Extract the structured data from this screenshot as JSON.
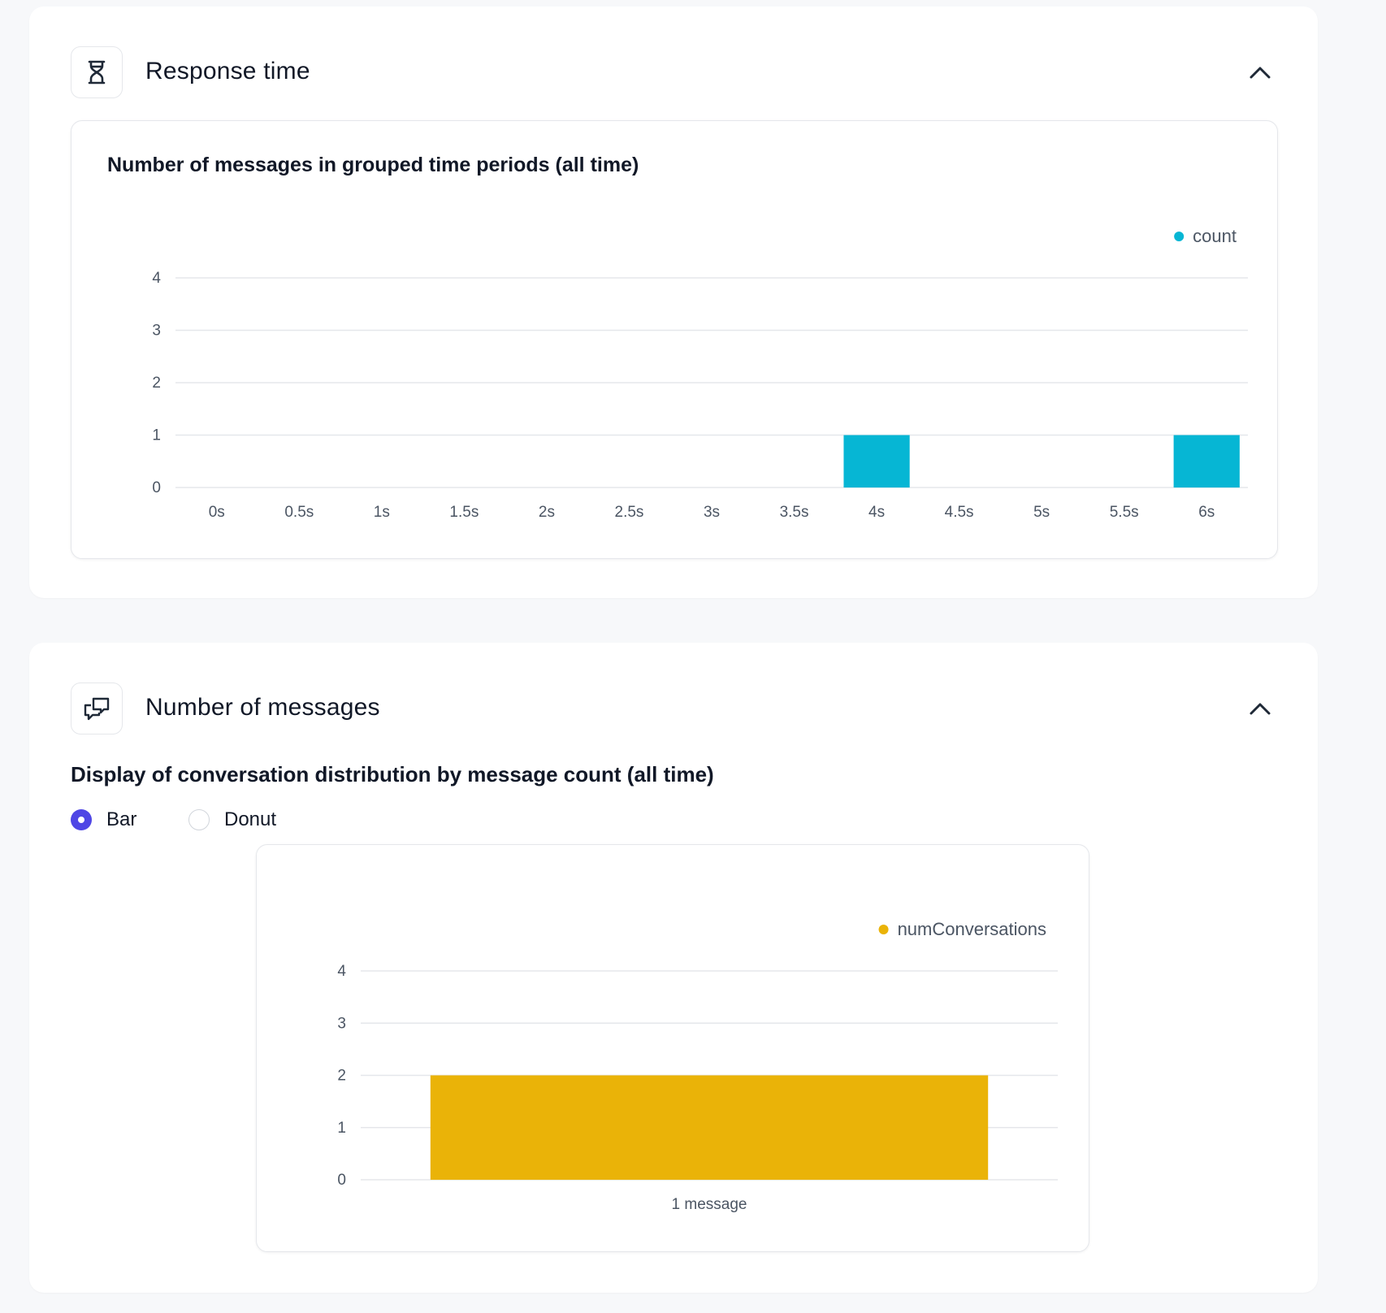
{
  "response_panel": {
    "title": "Response time",
    "icon": "hourglass-icon",
    "collapse_icon": "chevron-up-icon",
    "chart_title": "Number of messages in grouped time periods (all time)"
  },
  "messages_panel": {
    "title": "Number of messages",
    "icon": "chat-bubbles-icon",
    "collapse_icon": "chevron-up-icon",
    "subtitle": "Display of conversation distribution by message count (all time)",
    "display_options": [
      {
        "label": "Bar",
        "selected": true
      },
      {
        "label": "Donut",
        "selected": false
      }
    ]
  },
  "chart_data": [
    {
      "type": "bar",
      "title": "Number of messages in grouped time periods (all time)",
      "categories": [
        "0s",
        "0.5s",
        "1s",
        "1.5s",
        "2s",
        "2.5s",
        "3s",
        "3.5s",
        "4s",
        "4.5s",
        "5s",
        "5.5s",
        "6s"
      ],
      "series": [
        {
          "name": "count",
          "color": "#06b6d4",
          "values": [
            0,
            0,
            0,
            0,
            0,
            0,
            0,
            0,
            1,
            0,
            0,
            0,
            1
          ]
        }
      ],
      "yticks": [
        0,
        1,
        2,
        3,
        4
      ],
      "ylim": [
        0,
        4
      ],
      "grid": true,
      "legend": "top-right"
    },
    {
      "type": "bar",
      "categories": [
        "1 message"
      ],
      "series": [
        {
          "name": "numConversations",
          "color": "#eab308",
          "values": [
            2
          ]
        }
      ],
      "yticks": [
        0,
        1,
        2,
        3,
        4
      ],
      "ylim": [
        0,
        4
      ],
      "grid": true,
      "legend": "top-right"
    }
  ]
}
